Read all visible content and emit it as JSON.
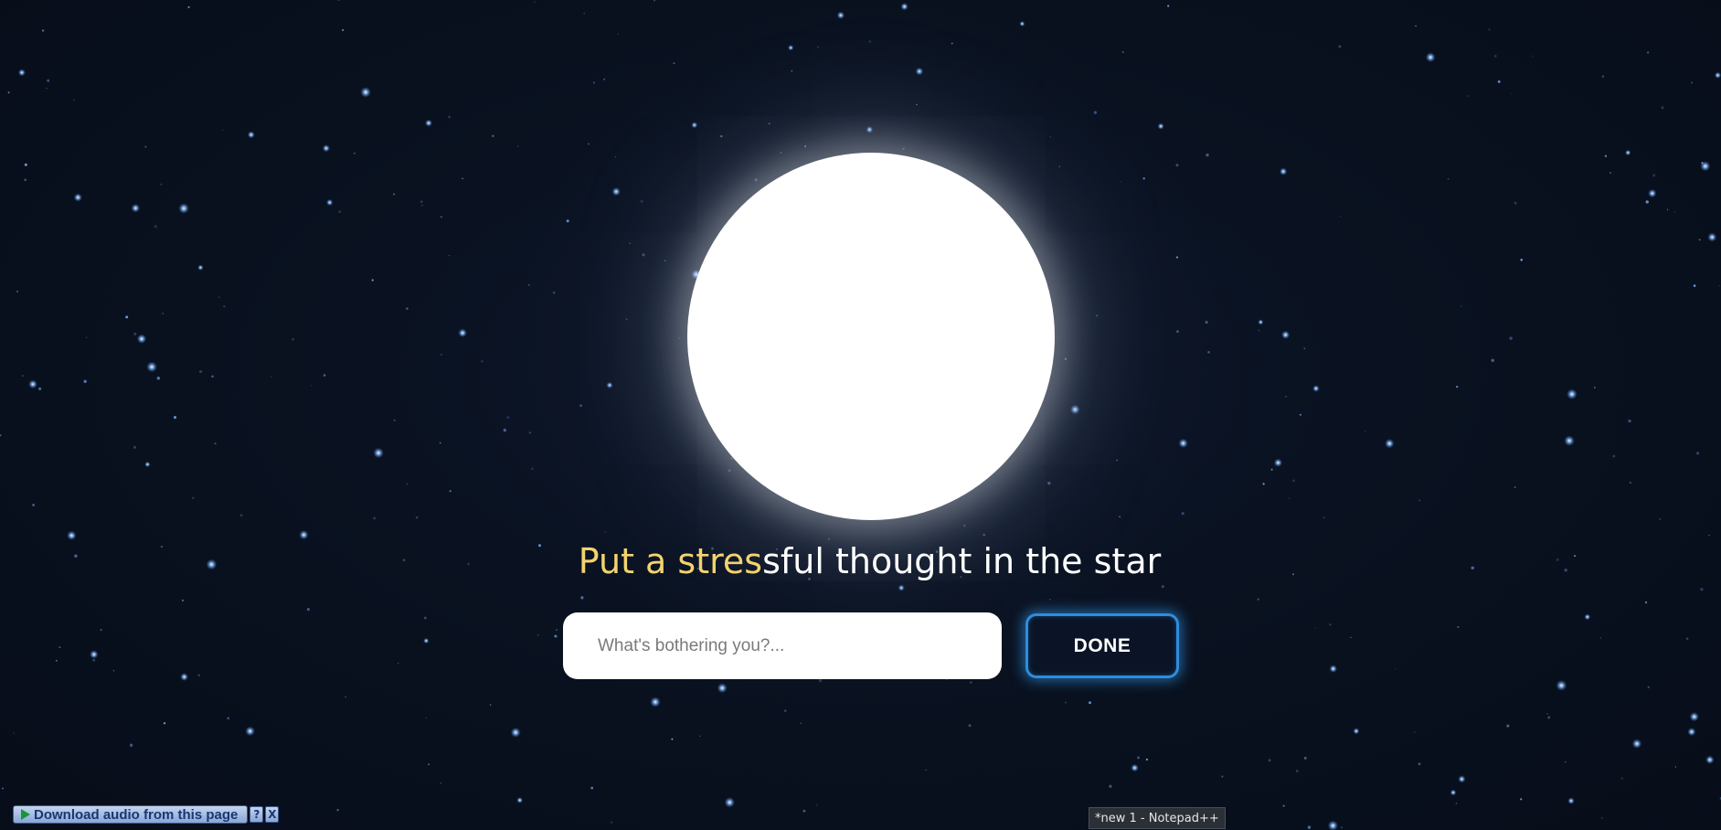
{
  "colors": {
    "background": "#08101f",
    "headline_accent": "#f3d36f",
    "headline_text": "#ffffff",
    "done_border": "#2e8ddc",
    "star": "#7fb4ff"
  },
  "headline": {
    "highlighted": "Put a stres",
    "rest": "sful thought in the star"
  },
  "thought_input": {
    "value": "",
    "placeholder": "What's bothering you?..."
  },
  "done_button": {
    "label": "DONE"
  },
  "audio_extension": {
    "label": "Download audio from this page",
    "help_label": "?",
    "close_label": "X",
    "play_icon": "play-icon"
  },
  "taskbar_tooltip": {
    "label": "*new 1 - Notepad++"
  }
}
